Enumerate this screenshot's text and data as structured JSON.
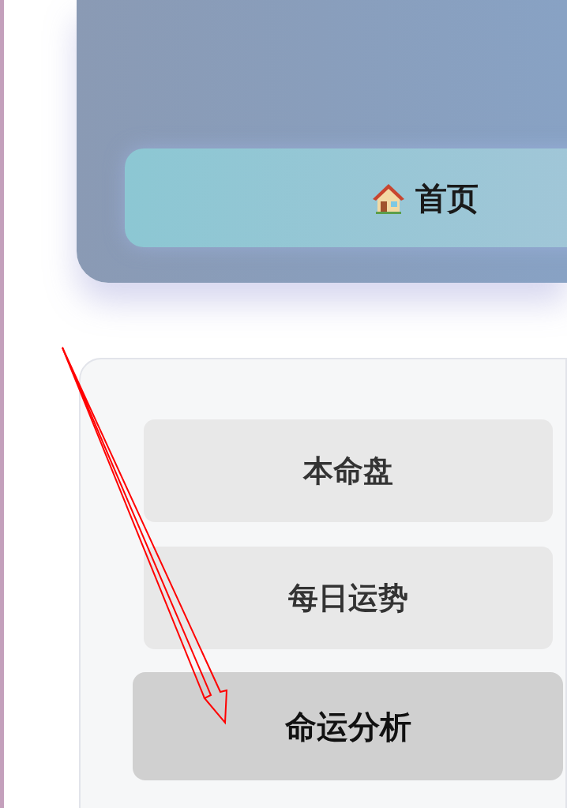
{
  "header": {
    "home_button": {
      "label": "首页"
    }
  },
  "menu": {
    "items": [
      {
        "label": "本命盘",
        "selected": false
      },
      {
        "label": "每日运势",
        "selected": false
      },
      {
        "label": "命运分析",
        "selected": true
      }
    ]
  }
}
